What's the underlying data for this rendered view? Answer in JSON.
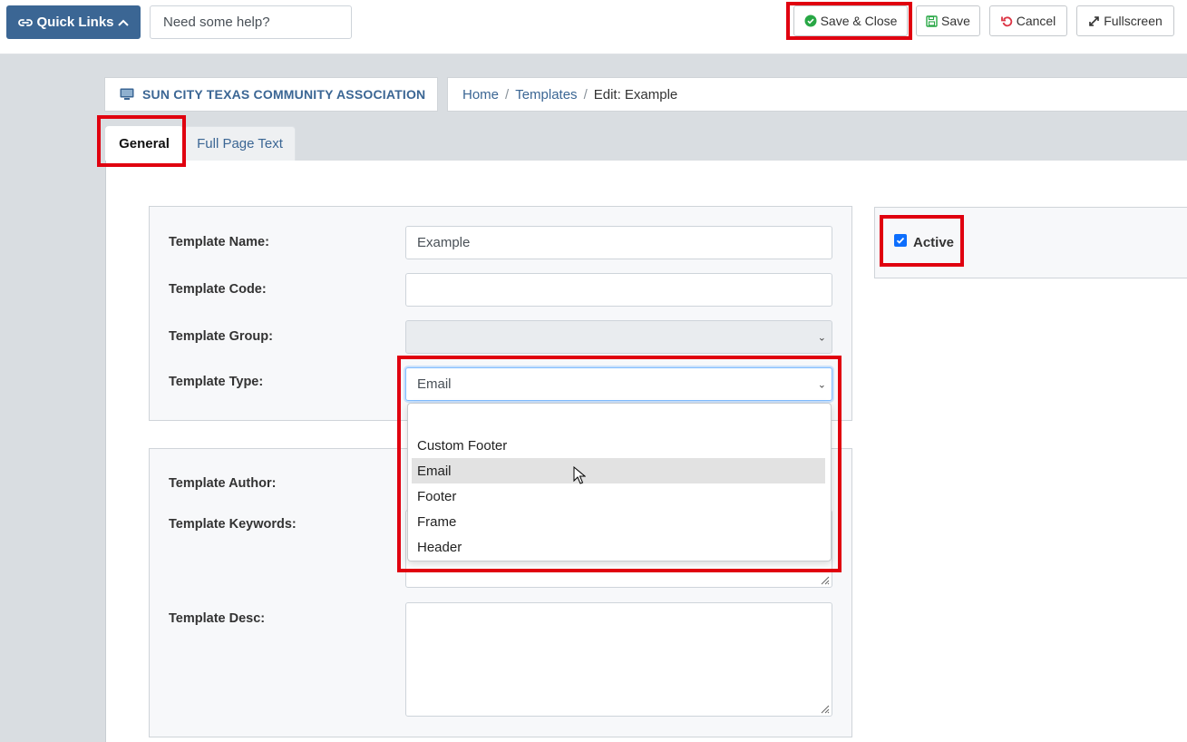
{
  "topbar": {
    "quick_links_label": "Quick Links",
    "help_placeholder": "Need some help?",
    "save_close_label": "Save & Close",
    "save_label": "Save",
    "cancel_label": "Cancel",
    "fullscreen_label": "Fullscreen"
  },
  "org": {
    "name": "SUN CITY TEXAS COMMUNITY ASSOCIATION"
  },
  "breadcrumb": {
    "home": "Home",
    "templates": "Templates",
    "current": "Edit: Example"
  },
  "tabs": {
    "general": "General",
    "full_page_text": "Full Page Text"
  },
  "form": {
    "template_name_label": "Template Name:",
    "template_name_value": "Example",
    "template_code_label": "Template Code:",
    "template_code_value": "",
    "template_group_label": "Template Group:",
    "template_type_label": "Template Type:",
    "template_type_value": "Email",
    "template_author_label": "Template Author:",
    "template_keywords_label": "Template Keywords:",
    "template_desc_label": "Template Desc:"
  },
  "dropdown": {
    "options": [
      "",
      "Custom Footer",
      "Email",
      "Footer",
      "Frame",
      "Header"
    ],
    "selected": "Email"
  },
  "active": {
    "label": "Active",
    "checked": true
  },
  "colors": {
    "accent": "#3b6694",
    "highlight": "#e0000f",
    "success": "#28a745",
    "danger": "#dc3545",
    "checkbox": "#0d6efd"
  }
}
